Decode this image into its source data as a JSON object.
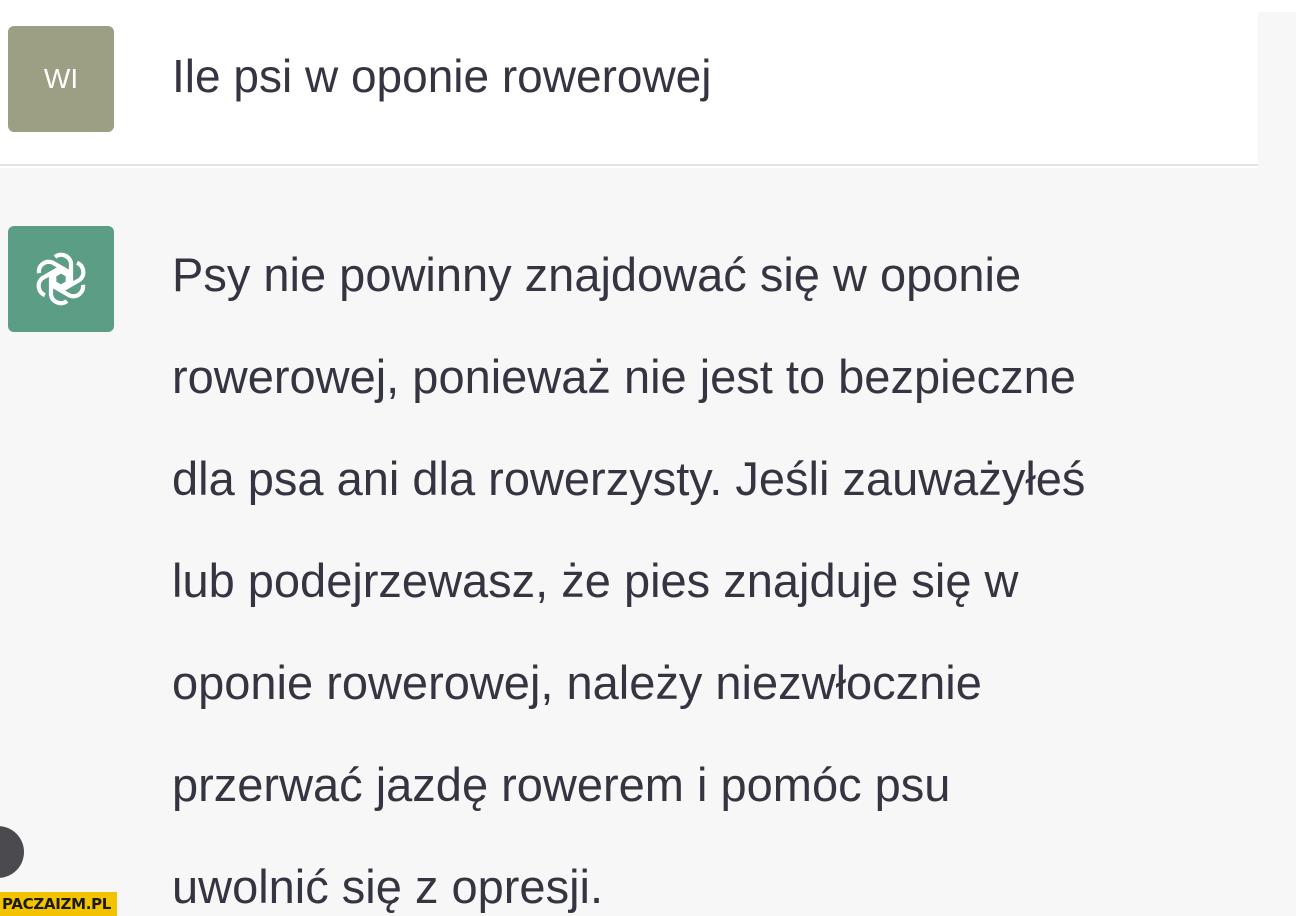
{
  "user_message": {
    "avatar_initials": "WI",
    "text": "Ile psi w oponie rowerowej"
  },
  "assistant_message": {
    "avatar_icon": "openai-logo-icon",
    "lines": [
      "Psy nie powinny znajdować się w oponie",
      "rowerowej, ponieważ nie jest to bezpieczne",
      "dla psa ani dla rowerzysty. Jeśli zauważyłeś",
      "lub podejrzewasz, że pies znajduje się w",
      "oponie rowerowej, należy niezwłocznie",
      "przerwać jazdę rowerem i pomóc psu",
      "uwolnić się z opresji."
    ]
  },
  "watermark": {
    "text": "PACZAIZM.PL"
  },
  "colors": {
    "user_avatar": "#9c9f84",
    "assistant_avatar": "#5b9e85",
    "assistant_bg": "#f7f7f8",
    "watermark_bg": "#f4c300"
  }
}
